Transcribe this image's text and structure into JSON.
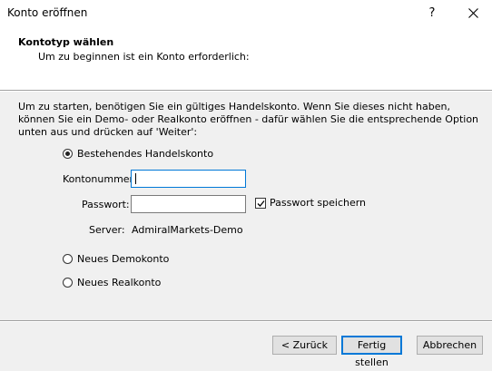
{
  "window": {
    "title": "Konto eröffnen",
    "help_label": "?"
  },
  "header": {
    "title": "Kontotyp wählen",
    "subtitle": "Um zu beginnen ist ein Konto erforderlich:"
  },
  "intro_text": "Um zu starten, benötigen Sie ein gültiges Handelskonto. Wenn Sie dieses nicht haben, können Sie ein Demo- oder Realkonto eröffnen - dafür wählen Sie die entsprechende Option unten aus und drücken auf 'Weiter':",
  "options": {
    "existing": {
      "label": "Bestehendes Handelskonto",
      "checked": true
    },
    "demo": {
      "label": "Neues Demokonto",
      "checked": false
    },
    "real": {
      "label": "Neues Realkonto",
      "checked": false
    }
  },
  "form": {
    "account_label": "Kontonummer:",
    "account_value": "",
    "password_label": "Passwort:",
    "password_value": "",
    "save_password_label": "Passwort speichern",
    "save_password_checked": true,
    "server_label": "Server:",
    "server_value": "AdmiralMarkets-Demo"
  },
  "buttons": {
    "back": "< Zurück",
    "finish": "Fertig stellen",
    "cancel": "Abbrechen"
  }
}
